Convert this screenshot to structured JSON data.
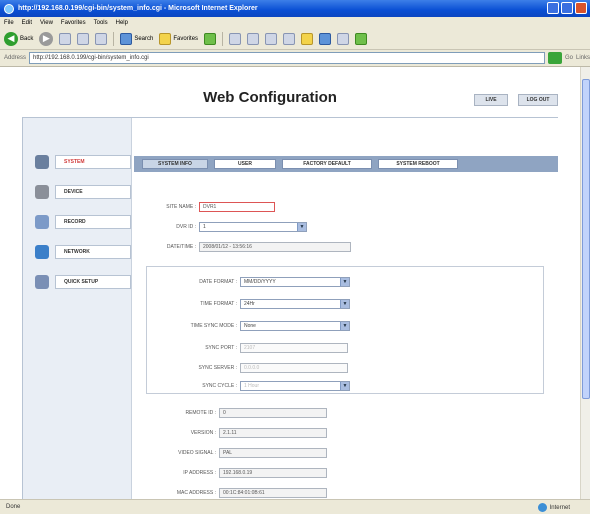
{
  "browser": {
    "title": "http://192.168.0.199/cgi-bin/system_info.cgi - Microsoft Internet Explorer",
    "menu": [
      "File",
      "Edit",
      "View",
      "Favorites",
      "Tools",
      "Help"
    ],
    "toolbar": {
      "back_label": "Back",
      "search_label": "Search",
      "favorites_label": "Favorites"
    },
    "address_label": "Address",
    "address": "http://192.168.0.199/cgi-bin/system_info.cgi",
    "go_label": "Go",
    "links_label": "Links",
    "status_left": "Done",
    "status_zone": "Internet"
  },
  "page": {
    "title": "Web Configuration",
    "top_buttons": {
      "live": "LIVE",
      "logout": "LOG OUT"
    }
  },
  "sidebar": {
    "items": [
      {
        "label": "SYSTEM",
        "icon": "system-icon",
        "color": "#6a7f9e"
      },
      {
        "label": "DEVICE",
        "icon": "device-icon",
        "color": "#8a8f99"
      },
      {
        "label": "RECORD",
        "icon": "record-icon",
        "color": "#7c9ac8"
      },
      {
        "label": "NETWORK",
        "icon": "network-icon",
        "color": "#3b7fc9"
      },
      {
        "label": "QUICK SETUP",
        "icon": "quick-setup-icon",
        "color": "#7a8fb5"
      }
    ]
  },
  "tabs": [
    "SYSTEM INFO",
    "USER",
    "FACTORY DEFAULT",
    "SYSTEM REBOOT"
  ],
  "system_info": {
    "site_name": {
      "label": "SITE NAME :",
      "value": "DVR1"
    },
    "dvr_id": {
      "label": "DVR ID :",
      "value": "1"
    },
    "datetime": {
      "label": "DATE/TIME :",
      "value": "2008/01/12 - 13:56:16"
    },
    "date_format": {
      "label": "DATE FORMAT :",
      "value": "MM/DD/YYYY"
    },
    "time_format": {
      "label": "TIME FORMAT :",
      "value": "24Hr"
    },
    "time_sync_mode": {
      "label": "TIME SYNC MODE :",
      "value": "None"
    },
    "sync_port": {
      "label": "SYNC PORT :",
      "value": "2107"
    },
    "sync_server": {
      "label": "SYNC SERVER :",
      "value": "0.0.0.0"
    },
    "sync_cycle": {
      "label": "SYNC CYCLE :",
      "value": "1 Hour"
    },
    "remote_id": {
      "label": "REMOTE ID :",
      "value": "0"
    },
    "version": {
      "label": "VERSION :",
      "value": "2.1.11"
    },
    "video_signal": {
      "label": "VIDEO SIGNAL :",
      "value": "PAL"
    },
    "ip_address": {
      "label": "IP ADDRESS :",
      "value": "192.168.0.19"
    },
    "mac_address": {
      "label": "MAC ADDRESS :",
      "value": "00:1C:84:01:0B:61"
    }
  },
  "colors": {
    "accent": "#8fa4c2",
    "active_label": "#d03a3a",
    "xp_blue": "#0a4fd4"
  }
}
